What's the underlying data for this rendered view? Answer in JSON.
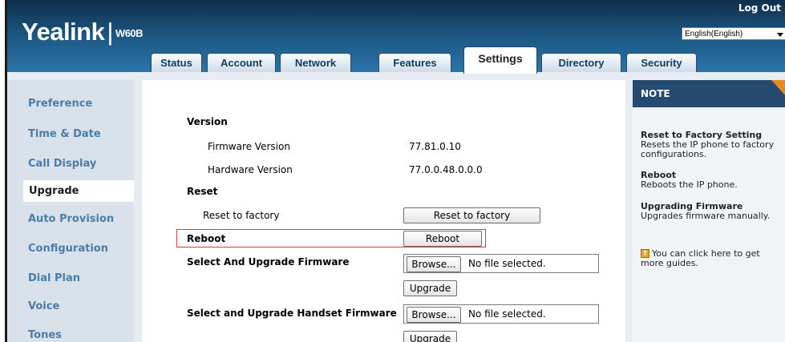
{
  "header": {
    "brand": "Yealink",
    "model": "W60B",
    "logout": "Log Out",
    "language": "English(English)"
  },
  "tabs": [
    {
      "label": "Status"
    },
    {
      "label": "Account"
    },
    {
      "label": "Network"
    },
    {
      "label": "Features"
    },
    {
      "label": "Settings",
      "active": true
    },
    {
      "label": "Directory"
    },
    {
      "label": "Security"
    }
  ],
  "sidebar": {
    "items": [
      {
        "label": "Preference"
      },
      {
        "label": "Time & Date"
      },
      {
        "label": "Call Display"
      },
      {
        "label": "Upgrade",
        "active": true
      },
      {
        "label": "Auto Provision"
      },
      {
        "label": "Configuration"
      },
      {
        "label": "Dial Plan"
      },
      {
        "label": "Voice"
      },
      {
        "label": "Tones"
      }
    ]
  },
  "content": {
    "version_heading": "Version",
    "firmware_label": "Firmware Version",
    "firmware_value": "77.81.0.10",
    "hardware_label": "Hardware Version",
    "hardware_value": "77.0.0.48.0.0.0",
    "reset_heading": "Reset",
    "reset_label": "Reset to factory",
    "reset_button": "Reset to factory",
    "reboot_label": "Reboot",
    "reboot_button": "Reboot",
    "firmware_upgrade_label": "Select And Upgrade Firmware",
    "browse_button": "Browse...",
    "no_file": "No file selected.",
    "upgrade_button": "Upgrade",
    "handset_upgrade_label": "Select and Upgrade Handset Firmware"
  },
  "note": {
    "title": "NOTE",
    "reset_title": "Reset to Factory Setting",
    "reset_line1": "Resets the IP phone to factory",
    "reset_line2": "configurations.",
    "reboot_title": "Reboot",
    "reboot_line1": "Reboots the IP phone.",
    "upgrade_title": "Upgrading Firmware",
    "upgrade_line1": "Upgrades firmware manually.",
    "guide_line1": "You can click here to get",
    "guide_line2": "more guides."
  },
  "colors": {
    "header": "#1d5a86",
    "sidebar_text": "#4c7da6",
    "highlight": "#e0373a",
    "note_accent": "#e88a22"
  }
}
